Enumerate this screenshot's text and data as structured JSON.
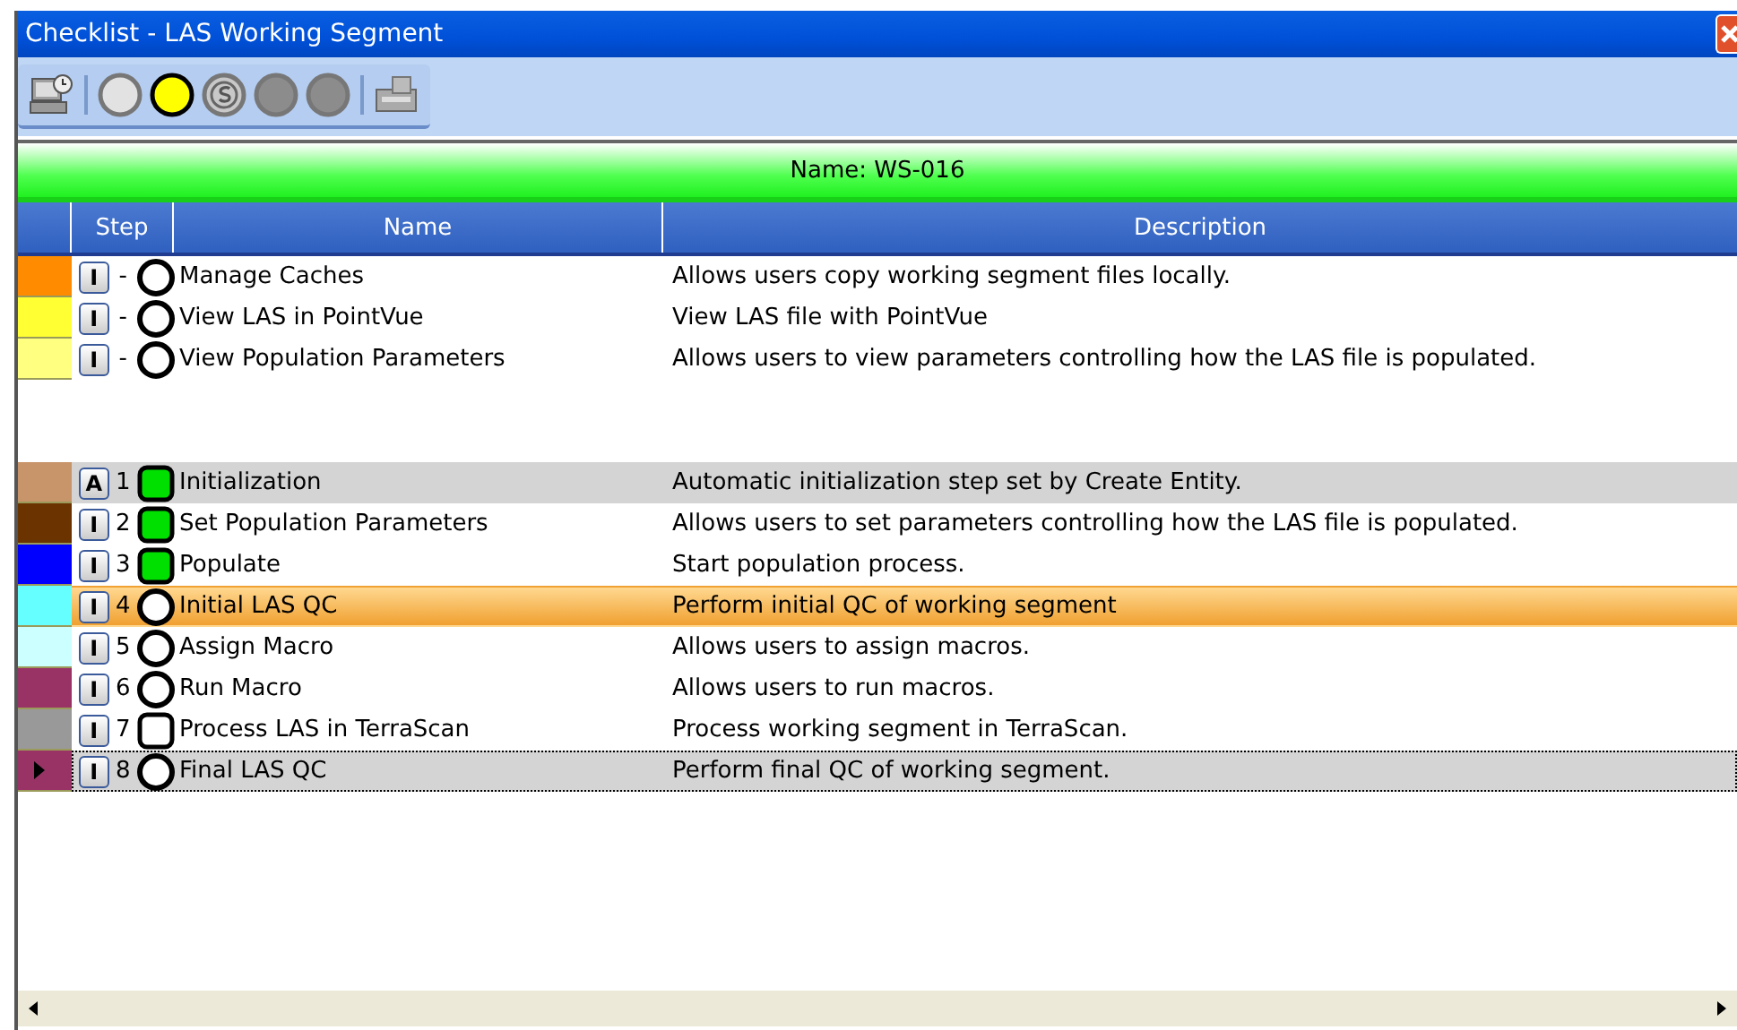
{
  "window": {
    "title": "Checklist - LAS Working Segment"
  },
  "toolbar": [
    {
      "kind": "computer"
    },
    {
      "kind": "separator"
    },
    {
      "kind": "light",
      "color": "#e2e2e2"
    },
    {
      "kind": "light",
      "color": "#ffff00"
    },
    {
      "kind": "s"
    },
    {
      "kind": "light",
      "color": "#8c8c8c"
    },
    {
      "kind": "light",
      "color": "#8c8c8c"
    },
    {
      "kind": "separator"
    },
    {
      "kind": "tray"
    }
  ],
  "name_bar": "Name: WS-016",
  "table": {
    "columns": [
      "Step",
      "Name",
      "Description"
    ],
    "groups": [
      {
        "rows": [
          {
            "color": "#ff8c00",
            "mode": "I",
            "step": "-",
            "kind": "round",
            "completed": false,
            "name": "Manage Caches",
            "description": "Allows users copy working segment files locally.",
            "selected": false,
            "in_progress": false,
            "current": false
          },
          {
            "color": "#ffff33",
            "mode": "I",
            "step": "-",
            "kind": "round",
            "completed": false,
            "name": "View LAS in PointVue",
            "description": "View LAS file with PointVue",
            "selected": false,
            "in_progress": false,
            "current": false
          },
          {
            "color": "#ffff80",
            "mode": "I",
            "step": "-",
            "kind": "round",
            "completed": false,
            "name": "View Population Parameters",
            "description": "Allows users to view parameters controlling how the LAS file is populated.",
            "selected": false,
            "in_progress": false,
            "current": false
          }
        ]
      },
      {
        "rows": [
          {
            "color": "#c8956a",
            "mode": "A",
            "step": "1",
            "kind": "square",
            "completed": true,
            "name": "Initialization",
            "description": "Automatic initialization step set by Create Entity.",
            "selected": true,
            "in_progress": false,
            "current": false
          },
          {
            "color": "#6b3300",
            "mode": "I",
            "step": "2",
            "kind": "square",
            "completed": true,
            "name": "Set Population Parameters",
            "description": "Allows users to set parameters controlling how the LAS file is populated.",
            "selected": false,
            "in_progress": false,
            "current": false
          },
          {
            "color": "#0000ff",
            "mode": "I",
            "step": "3",
            "kind": "square",
            "completed": true,
            "name": "Populate",
            "description": "Start population process.",
            "selected": false,
            "in_progress": false,
            "current": false
          },
          {
            "color": "#66ffff",
            "mode": "I",
            "step": "4",
            "kind": "round",
            "completed": false,
            "name": "Initial LAS QC",
            "description": "Perform initial QC of working segment",
            "selected": false,
            "in_progress": true,
            "current": false
          },
          {
            "color": "#ccffff",
            "mode": "I",
            "step": "5",
            "kind": "round",
            "completed": false,
            "name": "Assign Macro",
            "description": "Allows users to assign macros.",
            "selected": false,
            "in_progress": false,
            "current": false
          },
          {
            "color": "#993366",
            "mode": "I",
            "step": "6",
            "kind": "round",
            "completed": false,
            "name": "Run Macro",
            "description": "Allows users to run macros.",
            "selected": false,
            "in_progress": false,
            "current": false
          },
          {
            "color": "#999999",
            "mode": "I",
            "step": "7",
            "kind": "square",
            "completed": false,
            "name": "Process LAS in TerraScan",
            "description": "Process working segment in TerraScan.",
            "selected": false,
            "in_progress": false,
            "current": false
          },
          {
            "color": "#993366",
            "mode": "I",
            "step": "8",
            "kind": "round",
            "completed": false,
            "name": "Final LAS QC",
            "description": "Perform final QC of working segment.",
            "selected": true,
            "in_progress": false,
            "current": true
          }
        ]
      }
    ]
  }
}
